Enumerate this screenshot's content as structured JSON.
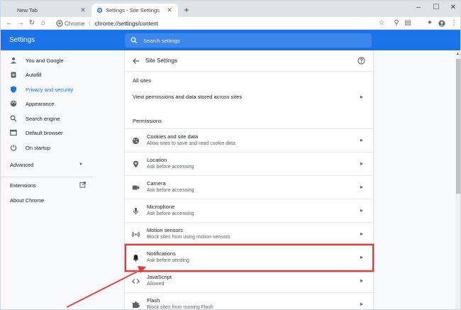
{
  "tabs": [
    {
      "title": "New Tab",
      "active": false
    },
    {
      "title": "Settings - Site Settings",
      "active": true
    }
  ],
  "toolbar": {
    "chip": "Chrome",
    "url": "chrome://settings/content"
  },
  "header": {
    "title": "Settings",
    "search_placeholder": "Search settings"
  },
  "sidebar": {
    "items": [
      {
        "label": "You and Google",
        "icon": "person-icon"
      },
      {
        "label": "Autofill",
        "icon": "clipboard-icon"
      },
      {
        "label": "Privacy and security",
        "icon": "shield-icon",
        "active": true
      },
      {
        "label": "Appearance",
        "icon": "palette-icon"
      },
      {
        "label": "Search engine",
        "icon": "search-icon"
      },
      {
        "label": "Default browser",
        "icon": "browser-icon"
      },
      {
        "label": "On startup",
        "icon": "power-icon"
      }
    ],
    "advanced": "Advanced",
    "extensions": "Extensions",
    "about": "About Chrome"
  },
  "panel": {
    "title": "Site Settings",
    "all_sites_label": "All sites",
    "all_sites_row": "View permissions and data stored across sites",
    "permissions_label": "Permissions",
    "permissions": [
      {
        "title": "Cookies and site data",
        "sub": "Allow sites to save and read cookie data",
        "icon": "cookie-icon"
      },
      {
        "title": "Location",
        "sub": "Ask before accessing",
        "icon": "location-icon"
      },
      {
        "title": "Camera",
        "sub": "Ask before accessing",
        "icon": "camera-icon"
      },
      {
        "title": "Microphone",
        "sub": "Ask before accessing",
        "icon": "microphone-icon"
      },
      {
        "title": "Motion sensors",
        "sub": "Block sites from using motion sensors",
        "icon": "motion-sensors-icon"
      },
      {
        "title": "Notifications",
        "sub": "Ask before sending",
        "icon": "bell-icon"
      },
      {
        "title": "JavaScript",
        "sub": "Allowed",
        "icon": "code-icon"
      },
      {
        "title": "Flash",
        "sub": "Block sites from running Flash",
        "icon": "puzzle-icon"
      }
    ]
  },
  "colors": {
    "accent": "#1a73e8",
    "highlight": "#e03c3c"
  }
}
